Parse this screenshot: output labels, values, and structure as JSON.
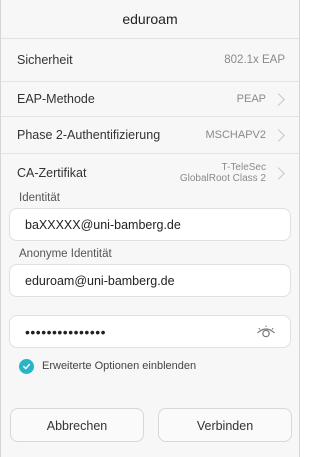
{
  "dialog": {
    "title": "eduroam"
  },
  "settings": [
    {
      "label": "Sicherheit",
      "value": "802.1x EAP"
    },
    {
      "label": "EAP-Methode",
      "value": "PEAP"
    },
    {
      "label": "Phase 2-Authentifizierung",
      "value": "MSCHAPV2"
    },
    {
      "label": "CA-Zertifikat",
      "value_line1": "T-TeleSec",
      "value_line2": "GlobalRoot Class 2"
    }
  ],
  "identity": {
    "label": "Identität",
    "value": "baXXXXX@uni-bamberg.de"
  },
  "anonymous_identity": {
    "label": "Anonyme Identität",
    "value": "eduroam@uni-bamberg.de"
  },
  "password": {
    "masked_value": "•••••••••••••••",
    "toggle_icon": "eye-icon"
  },
  "advanced": {
    "label": "Erweiterte Optionen einblenden",
    "checked": true,
    "accent_color": "#2bb3c8"
  },
  "buttons": {
    "cancel": "Abbrechen",
    "connect": "Verbinden"
  }
}
